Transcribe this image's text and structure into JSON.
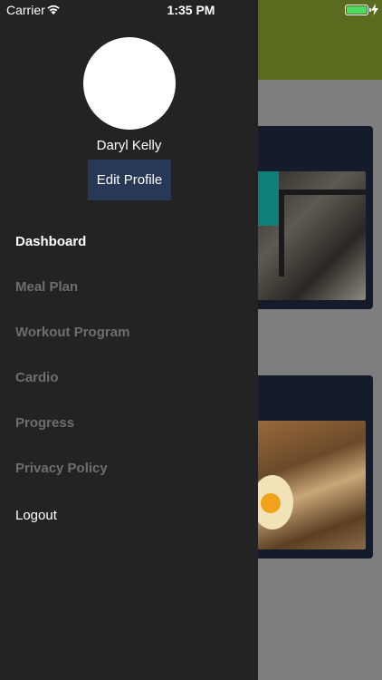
{
  "status_bar": {
    "carrier": "Carrier",
    "time": "1:35 PM",
    "battery_color": "#4cd964"
  },
  "drawer": {
    "user_name": "Daryl Kelly",
    "edit_profile_label": "Edit Profile",
    "menu_items": [
      {
        "label": "Dashboard",
        "active": true
      },
      {
        "label": "Meal Plan",
        "active": false
      },
      {
        "label": "Workout Program",
        "active": false
      },
      {
        "label": "Cardio",
        "active": false
      },
      {
        "label": "Progress",
        "active": false
      },
      {
        "label": "Privacy Policy",
        "active": false
      }
    ],
    "logout_label": "Logout"
  },
  "colors": {
    "drawer_bg": "#232323",
    "edit_button_bg": "#283958",
    "header_bg": "#5a6a1e",
    "card_bg": "#141b2a"
  }
}
